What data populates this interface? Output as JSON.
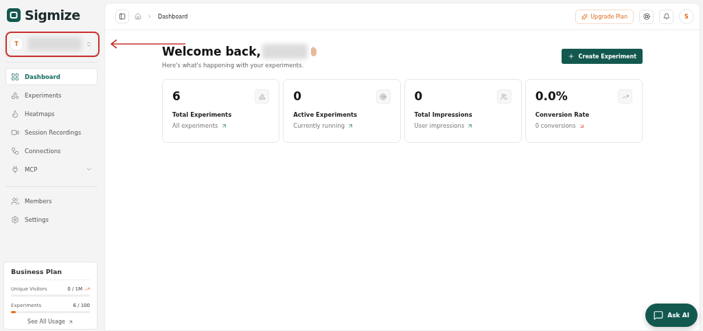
{
  "brand": {
    "name": "Sigmize"
  },
  "workspace": {
    "avatar": "T"
  },
  "sidebar": {
    "items": [
      {
        "label": "Dashboard",
        "selected": true
      },
      {
        "label": "Experiments",
        "selected": false
      },
      {
        "label": "Heatmaps",
        "selected": false
      },
      {
        "label": "Session Recordings",
        "selected": false
      },
      {
        "label": "Connections",
        "selected": false
      },
      {
        "label": "MCP",
        "selected": false,
        "expanded": false
      }
    ],
    "secondary_items": [
      {
        "label": "Members",
        "selected": false
      },
      {
        "label": "Settings",
        "selected": false
      }
    ]
  },
  "plan": {
    "title": "Business Plan",
    "meters": [
      {
        "label": "Unique Visitors",
        "reading": "0 / 1M",
        "level": 0,
        "trend": true
      },
      {
        "label": "Experiments",
        "reading": "6 / 100",
        "level": 0.06,
        "trend": false
      }
    ],
    "link": "See All Usage"
  },
  "breadcrumb": [
    "Dashboard"
  ],
  "topbar": {
    "upgrade": "Upgrade Plan",
    "avatar": "S"
  },
  "header": {
    "title": "Welcome back,",
    "subtitle": "Here's what's happening with your experiments.",
    "action": "Create Experiment"
  },
  "stats": [
    {
      "value": "6",
      "label": "Total Experiments",
      "note": "All experiments",
      "positive": true
    },
    {
      "value": "0",
      "label": "Active Experiments",
      "note": "Currently running",
      "positive": true
    },
    {
      "value": "0",
      "label": "Total Impressions",
      "note": "User impressions",
      "positive": true
    },
    {
      "value": "0.0%",
      "label": "Conversion Rate",
      "note": "0 conversions",
      "positive": false
    }
  ],
  "assistant": {
    "label": "Ask AI"
  }
}
